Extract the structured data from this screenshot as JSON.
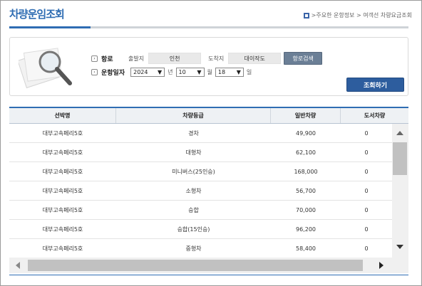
{
  "page": {
    "title": "차량운임조회",
    "breadcrumb": ">주요한 운항정보 > 여객선 차량요금조회"
  },
  "search": {
    "route_label": "항로",
    "departure_label": "출발지",
    "departure_value": "인천",
    "arrival_label": "도착지",
    "arrival_value": "대이작도",
    "route_search_button": "항로검색",
    "date_label": "운항일자",
    "year": "2024",
    "year_unit": "년",
    "month": "10",
    "month_unit": "월",
    "day": "18",
    "day_unit": "일",
    "submit_button": "조회하기"
  },
  "table": {
    "columns": [
      "선박명",
      "차량등급",
      "일반차량",
      "도서차량"
    ],
    "rows": [
      [
        "대부고속페리5호",
        "경차",
        "49,900",
        "0"
      ],
      [
        "대부고속페리5호",
        "대형차",
        "62,100",
        "0"
      ],
      [
        "대부고속페리5호",
        "미니버스(25인승)",
        "168,000",
        "0"
      ],
      [
        "대부고속페리5호",
        "소형차",
        "56,700",
        "0"
      ],
      [
        "대부고속페리5호",
        "승합",
        "70,000",
        "0"
      ],
      [
        "대부고속페리5호",
        "승합(15인승)",
        "96,200",
        "0"
      ],
      [
        "대부고속페리5호",
        "중형차",
        "58,400",
        "0"
      ]
    ]
  },
  "colors": {
    "accent": "#2f6db3",
    "button": "#2d5d9e",
    "route_button": "#6b7f96"
  }
}
